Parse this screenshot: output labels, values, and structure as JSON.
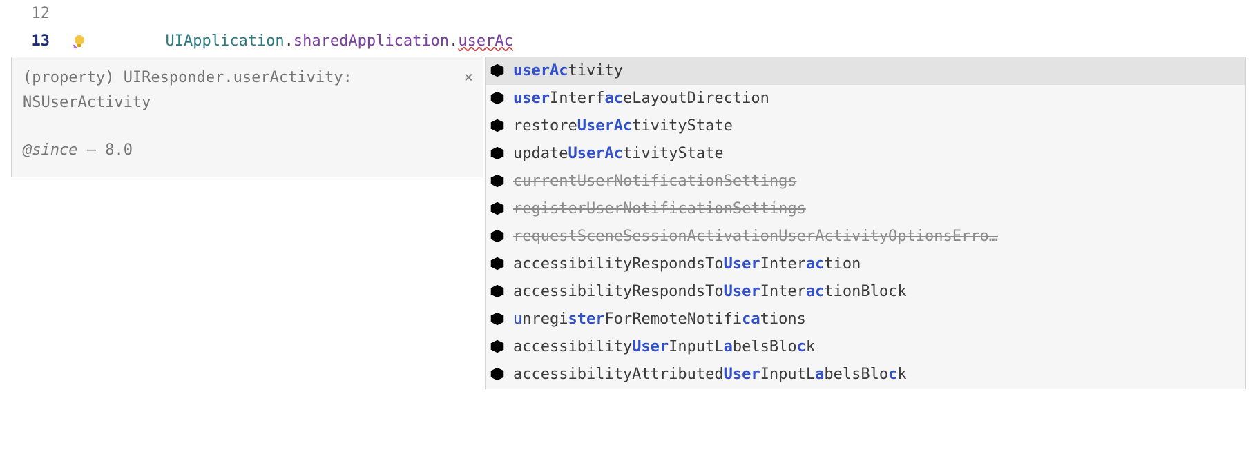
{
  "lines": [
    {
      "num": "12",
      "active": false
    },
    {
      "num": "13",
      "active": true,
      "code": {
        "type": "UIApplication",
        "dot1": ".",
        "prop1": "sharedApplication",
        "dot2": ".",
        "incomplete": "userAc"
      }
    }
  ],
  "doc": {
    "signature": "(property) UIResponder.userActivity: NSUserActivity",
    "since_label": "@since",
    "since_sep": " — ",
    "since_value": "8.0",
    "close": "×"
  },
  "suggestions": [
    {
      "kind": "field",
      "selected": true,
      "deprecated": false,
      "parts": [
        {
          "t": "userAc",
          "b": true
        },
        {
          "t": "tivity"
        }
      ]
    },
    {
      "kind": "field",
      "selected": false,
      "deprecated": false,
      "parts": [
        {
          "t": "user",
          "b": true
        },
        {
          "t": "Interf"
        },
        {
          "t": "ac",
          "b": true
        },
        {
          "t": "eLayoutDirection"
        }
      ]
    },
    {
      "kind": "method",
      "selected": false,
      "deprecated": false,
      "parts": [
        {
          "t": "restore"
        },
        {
          "t": "UserAc",
          "b": true
        },
        {
          "t": "tivityState"
        }
      ]
    },
    {
      "kind": "method",
      "selected": false,
      "deprecated": false,
      "parts": [
        {
          "t": "update"
        },
        {
          "t": "UserAc",
          "b": true
        },
        {
          "t": "tivityState"
        }
      ]
    },
    {
      "kind": "field",
      "selected": false,
      "deprecated": true,
      "parts": [
        {
          "t": "currentUserNotificationSettings"
        }
      ]
    },
    {
      "kind": "method",
      "selected": false,
      "deprecated": true,
      "parts": [
        {
          "t": "registerUserNotificationSettings"
        }
      ]
    },
    {
      "kind": "method",
      "selected": false,
      "deprecated": true,
      "parts": [
        {
          "t": "requestSceneSessionActivationUserActivityOptionsErro…"
        }
      ]
    },
    {
      "kind": "field",
      "selected": false,
      "deprecated": false,
      "parts": [
        {
          "t": "accessibilityRespondsTo"
        },
        {
          "t": "User",
          "b": true
        },
        {
          "t": "Inter"
        },
        {
          "t": "ac",
          "b": true
        },
        {
          "t": "tion"
        }
      ]
    },
    {
      "kind": "field",
      "selected": false,
      "deprecated": false,
      "parts": [
        {
          "t": "accessibilityRespondsTo"
        },
        {
          "t": "User",
          "b": true
        },
        {
          "t": "Inter"
        },
        {
          "t": "ac",
          "b": true
        },
        {
          "t": "tionBlock"
        }
      ]
    },
    {
      "kind": "method",
      "selected": false,
      "deprecated": false,
      "parts": [
        {
          "t": "u",
          "m": true
        },
        {
          "t": "nregi"
        },
        {
          "t": "st",
          "b": true
        },
        {
          "t": "er",
          "b": true
        },
        {
          "t": "ForRemoteNotifi"
        },
        {
          "t": "ca",
          "b": true
        },
        {
          "t": "tions"
        }
      ]
    },
    {
      "kind": "field",
      "selected": false,
      "deprecated": false,
      "parts": [
        {
          "t": "accessibility"
        },
        {
          "t": "User",
          "b": true
        },
        {
          "t": "InputL"
        },
        {
          "t": "a",
          "b": true
        },
        {
          "t": "belsBlo"
        },
        {
          "t": "c",
          "b": true
        },
        {
          "t": "k"
        }
      ]
    },
    {
      "kind": "field",
      "selected": false,
      "deprecated": false,
      "parts": [
        {
          "t": "accessibilityAttributed"
        },
        {
          "t": "User",
          "b": true
        },
        {
          "t": "InputL"
        },
        {
          "t": "a",
          "b": true
        },
        {
          "t": "belsBlo"
        },
        {
          "t": "c",
          "b": true
        },
        {
          "t": "k"
        }
      ]
    }
  ]
}
